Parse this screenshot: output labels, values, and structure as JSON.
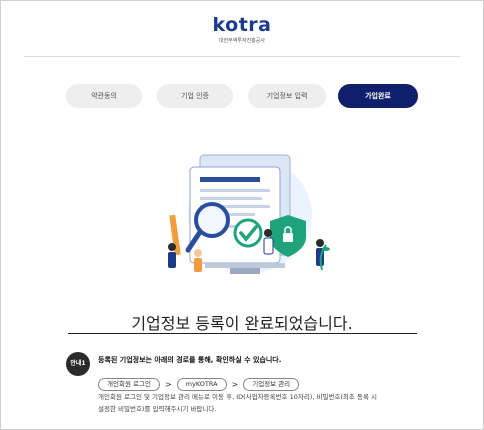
{
  "header": {
    "logo_text": "kotra",
    "logo_subtitle": "대한무역투자진흥공사"
  },
  "steps": [
    {
      "label": "약관동의",
      "active": false
    },
    {
      "label": "기업 인증",
      "active": false
    },
    {
      "label": "기업정보 입력",
      "active": false
    },
    {
      "label": "가입완료",
      "active": true
    }
  ],
  "main": {
    "completion_title": "기업정보 등록이 완료되었습니다."
  },
  "info": {
    "badge": "안내1",
    "headline": "등록된 기업정보는 아래의 경로를 통해, 확인하실 수 있습니다.",
    "path": [
      "개인회원 로그인",
      "myKOTRA",
      "기업정보 관리"
    ],
    "path_separator": ">",
    "description_line1": "개인회원 로그인 및 기업정보 관리 메뉴로 이동 후, ID(사업자등록번호 10자리), 비밀번호(최초 등록 시",
    "description_line2": "설정한 비밀번호)를 입력해주시기 바랍니다."
  },
  "colors": {
    "brand": "#1e3a8a",
    "active_step": "#0f1f6b",
    "inactive_step": "#eeeeee",
    "accent_green": "#1fa37a",
    "accent_orange": "#f39c3d"
  }
}
